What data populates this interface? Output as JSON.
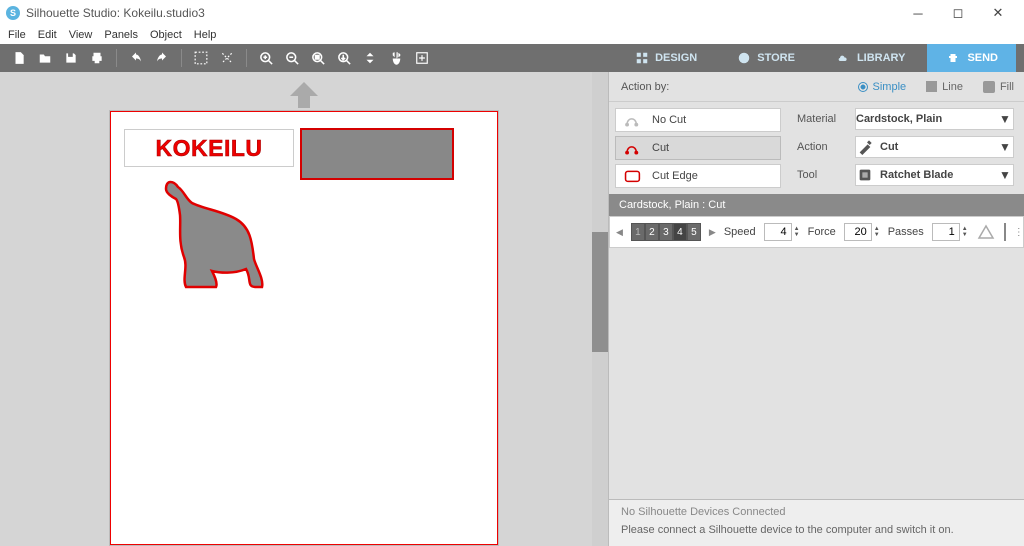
{
  "window": {
    "title": "Silhouette Studio: Kokeilu.studio3"
  },
  "menu": {
    "file": "File",
    "edit": "Edit",
    "view": "View",
    "panels": "Panels",
    "object": "Object",
    "help": "Help"
  },
  "tabs": {
    "design": "DESIGN",
    "store": "STORE",
    "library": "LIBRARY",
    "send": "SEND"
  },
  "action_by_label": "Action by:",
  "subtabs": {
    "simple": "Simple",
    "line": "Line",
    "fill": "Fill"
  },
  "cut_options": {
    "no_cut": "No Cut",
    "cut": "Cut",
    "cut_edge": "Cut Edge"
  },
  "props": {
    "material_label": "Material",
    "material_value": "Cardstock, Plain",
    "action_label": "Action",
    "action_value": "Cut",
    "tool_label": "Tool",
    "tool_value": "Ratchet Blade"
  },
  "cut_bar": "Cardstock, Plain : Cut",
  "params": {
    "speed_label": "Speed",
    "speed_value": "4",
    "force_label": "Force",
    "force_value": "20",
    "passes_label": "Passes",
    "passes_value": "1",
    "depth_bits": [
      "1",
      "2",
      "3",
      "4",
      "5"
    ]
  },
  "canvas": {
    "wordart_text": "KOKEILU"
  },
  "status": {
    "line1": "No Silhouette Devices Connected",
    "line2": "Please connect a Silhouette device to the computer and switch it on."
  }
}
